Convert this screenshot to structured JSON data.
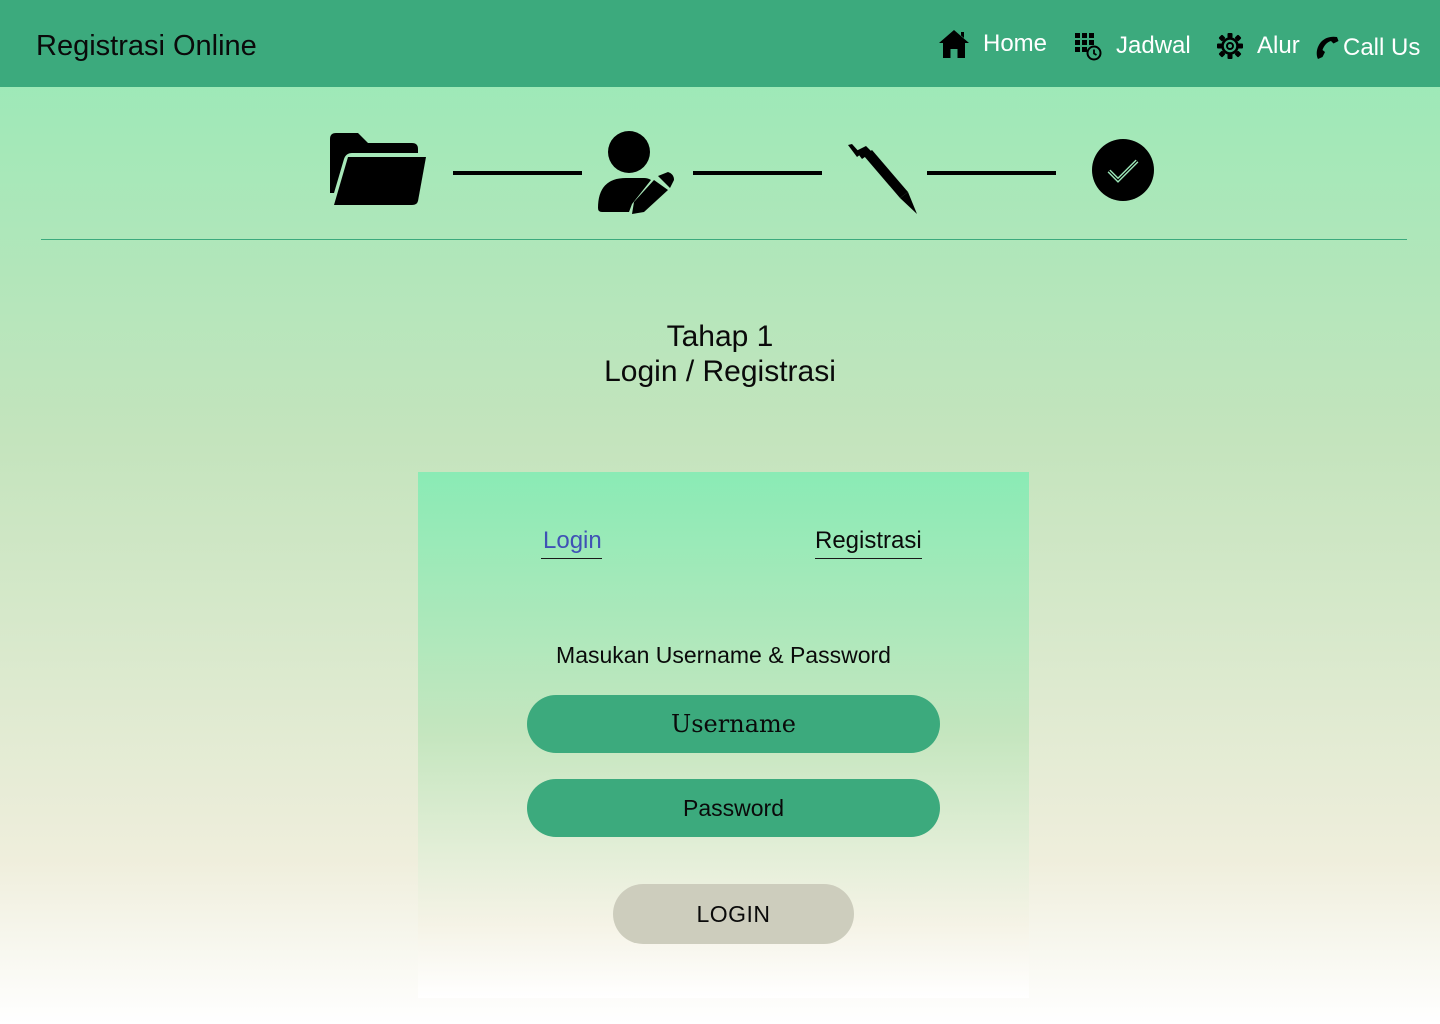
{
  "header": {
    "brand": "Registrasi Online",
    "nav": [
      {
        "label": "Home",
        "icon": "home-icon"
      },
      {
        "label": "Jadwal",
        "icon": "schedule-icon"
      },
      {
        "label": "Alur",
        "icon": "gear-icon"
      },
      {
        "label": "Call Us",
        "icon": "phone-icon"
      }
    ]
  },
  "stepper": {
    "steps": [
      {
        "icon": "folder-open-icon"
      },
      {
        "icon": "user-edit-icon"
      },
      {
        "icon": "pen-icon"
      },
      {
        "icon": "check-circle-icon"
      }
    ]
  },
  "heading": {
    "line1": "Tahap 1",
    "line2": "Login / Registrasi"
  },
  "form": {
    "tabs": [
      {
        "label": "Login",
        "active": true
      },
      {
        "label": "Registrasi",
        "active": false
      }
    ],
    "instruction": "Masukan Username & Password",
    "username_placeholder": "Username",
    "password_placeholder": "Password",
    "submit_label": "LOGIN"
  },
  "colors": {
    "navbar": "#3caa7d",
    "accent_link": "#3f51b5",
    "input_bg": "#3caa7d",
    "button_bg": "#cdcdbd"
  }
}
